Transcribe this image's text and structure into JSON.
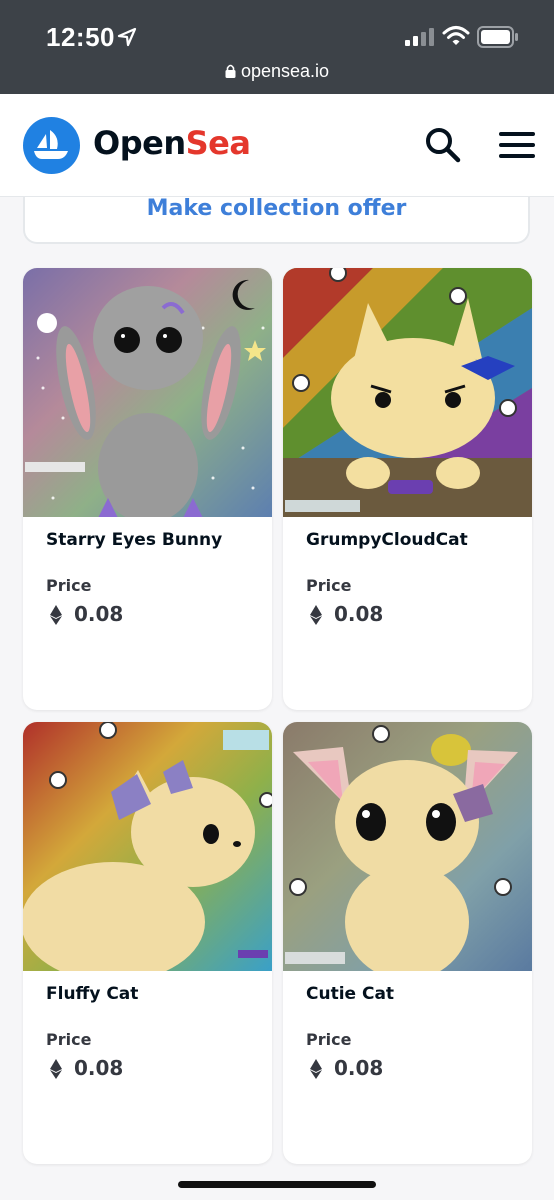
{
  "status_bar": {
    "time": "12:50",
    "url": "opensea.io"
  },
  "header": {
    "brand_open": "Open",
    "brand_sea": "Sea"
  },
  "offer_button": {
    "label": "Make collection offer"
  },
  "items": [
    {
      "title": "Starry Eyes Bunny",
      "price_label": "Price",
      "price": "0.08"
    },
    {
      "title": "GrumpyCloudCat",
      "price_label": "Price",
      "price": "0.08"
    },
    {
      "title": "Fluffy Cat",
      "price_label": "Price",
      "price": "0.08"
    },
    {
      "title": "Cutie Cat",
      "price_label": "Price",
      "price": "0.08"
    }
  ],
  "colors": {
    "accent": "#3e7fd9",
    "brand_blue": "#2081e2",
    "bolt_red": "#e4372c",
    "status_bar": "#3d4248"
  }
}
